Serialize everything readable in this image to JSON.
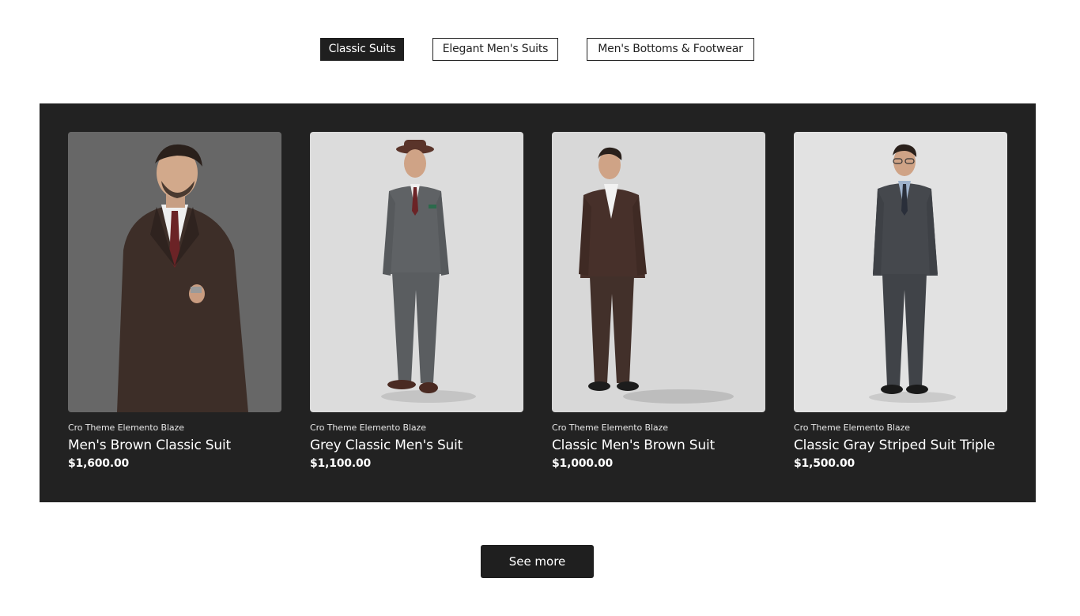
{
  "tabs": [
    {
      "label": "Classic Suits",
      "active": true
    },
    {
      "label": "Elegant Men's Suits",
      "active": false
    },
    {
      "label": "Men's Bottoms & Footwear",
      "active": false
    }
  ],
  "products": [
    {
      "vendor": "Cro Theme Elemento Blaze",
      "title": "Men's Brown Classic Suit",
      "price": "$1,600.00",
      "suit_color": "#3e2e28",
      "background": "#6f6f6f"
    },
    {
      "vendor": "Cro Theme Elemento Blaze",
      "title": "Grey Classic Men's Suit",
      "price": "$1,100.00",
      "suit_color": "#5f6265",
      "background": "#dcdcdc"
    },
    {
      "vendor": "Cro Theme Elemento Blaze",
      "title": "Classic Men's Brown Suit",
      "price": "$1,000.00",
      "suit_color": "#47302a",
      "background": "#d7d7d7"
    },
    {
      "vendor": "Cro Theme Elemento Blaze",
      "title": "Classic Gray Striped Suit Triple",
      "price": "$1,500.00",
      "suit_color": "#45484d",
      "background": "#e2e2e2"
    }
  ],
  "see_more_label": "See more",
  "colors": {
    "band": "#222222",
    "button": "#1f1f1f",
    "text_light": "#ffffff"
  }
}
